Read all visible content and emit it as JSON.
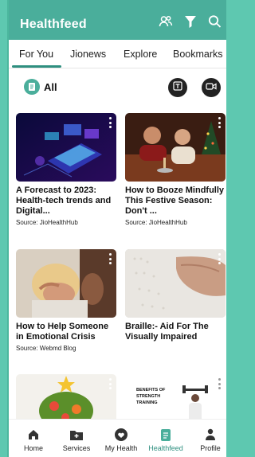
{
  "app": {
    "title": "Healthfeed"
  },
  "header_icons": [
    "people-icon",
    "filter-icon",
    "search-icon"
  ],
  "tabs": [
    {
      "label": "For You",
      "active": true
    },
    {
      "label": "Jionews",
      "active": false
    },
    {
      "label": "Explore",
      "active": false
    },
    {
      "label": "Bookmarks",
      "active": false
    }
  ],
  "filter": {
    "all_label": "All"
  },
  "cards": [
    {
      "title": "A Forecast to 2023: Health-tech trends and Digital...",
      "source": "Source: JioHealthHub"
    },
    {
      "title": "How to Booze Mindfully This Festive Season: Don't ...",
      "source": "Source: JioHealthHub"
    },
    {
      "title": "How to Help Someone in Emotional Crisis",
      "source": "Source: Webmd Blog"
    },
    {
      "title": "Braille:- Aid For The Visually Impaired",
      "source": ""
    },
    {
      "title": "",
      "source": ""
    },
    {
      "title": "",
      "source": "",
      "image_text": "BENEFITS OF STRENGTH TRAINING"
    }
  ],
  "bottom_nav": [
    {
      "label": "Home",
      "icon": "home-icon",
      "active": false
    },
    {
      "label": "Services",
      "icon": "folder-plus-icon",
      "active": false
    },
    {
      "label": "My Health",
      "icon": "heart-icon",
      "active": false
    },
    {
      "label": "Healthfeed",
      "icon": "document-icon",
      "active": true
    },
    {
      "label": "Profile",
      "icon": "person-icon",
      "active": false
    }
  ],
  "colors": {
    "accent": "#4aae9b",
    "accent_dark": "#2e8f7f",
    "background_edge": "#5ec8b0"
  }
}
